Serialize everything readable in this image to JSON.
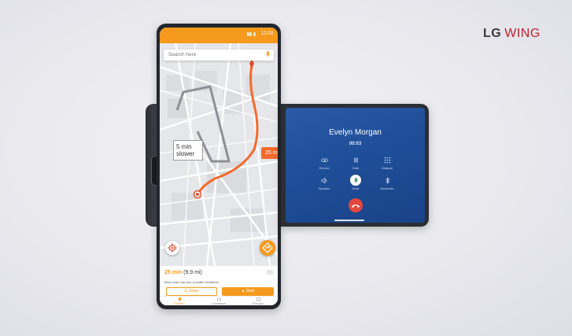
{
  "brand": {
    "lg": "LG",
    "wing": "WING"
  },
  "status_bar": {
    "time": "12:00",
    "signal_icon": "signal-battery-icon"
  },
  "map": {
    "search_placeholder": "Search here",
    "eta_box_line1": "5 min",
    "eta_box_line2": "slower",
    "traffic_tag": "25 m",
    "route_color": "#f46a2c",
    "alt_route_color": "#8d9096"
  },
  "panel": {
    "duration": "25 min",
    "distance": "(9.9 mi)",
    "note": "Best route now due to traffic conditions",
    "steps_label": "Steps",
    "start_label": "Start"
  },
  "tabs": [
    {
      "label": "Explore",
      "icon": "pin-icon",
      "active": true
    },
    {
      "label": "Commute",
      "icon": "commute-icon",
      "active": false
    },
    {
      "label": "For you",
      "icon": "sparkle-icon",
      "active": false
    }
  ],
  "call": {
    "caller": "Evelyn Morgan",
    "duration": "00:03",
    "controls": [
      {
        "label": "Record",
        "icon": "record-icon"
      },
      {
        "label": "Hold",
        "icon": "pause-icon"
      },
      {
        "label": "Dialpad",
        "icon": "dialpad-icon"
      },
      {
        "label": "Speaker",
        "icon": "speaker-icon"
      },
      {
        "label": "Mute",
        "icon": "microphone-icon"
      },
      {
        "label": "Bluetooth",
        "icon": "bluetooth-icon"
      }
    ],
    "end_call_icon": "end-call-icon"
  },
  "colors": {
    "accent": "#f59a1d",
    "call_bg": "#1e4d97",
    "end_call": "#e2463f"
  }
}
